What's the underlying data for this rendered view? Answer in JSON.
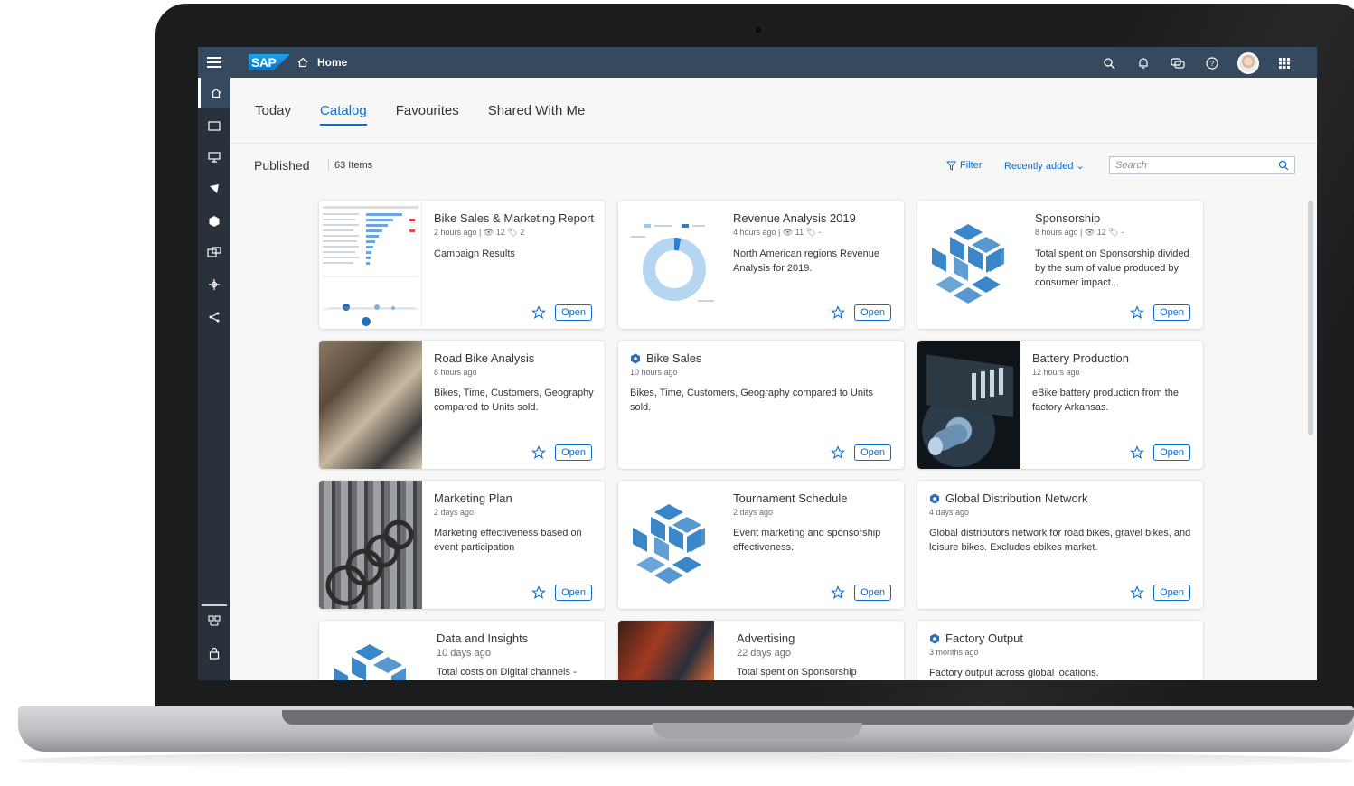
{
  "shell": {
    "logo": "SAP",
    "home_label": "Home"
  },
  "tabs": [
    {
      "label": "Today"
    },
    {
      "label": "Catalog",
      "active": true
    },
    {
      "label": "Favourites"
    },
    {
      "label": "Shared With Me"
    }
  ],
  "toolbar": {
    "title": "Published",
    "count": "63 Items",
    "filter_label": "Filter",
    "sort_label": "Recently added",
    "search_placeholder": "Search"
  },
  "open_label": "Open",
  "cards": [
    {
      "title": "Bike Sales & Marketing Report",
      "meta": "2 hours ago | 👁 12 🏷 2",
      "desc": "Campaign Results"
    },
    {
      "title": "Revenue Analysis 2019",
      "meta": "4 hours ago | 👁 11 🏷 -",
      "desc": "North American regions Revenue Analysis for 2019."
    },
    {
      "title": "Sponsorship",
      "meta": "8 hours ago | 👁 12 🏷 -",
      "desc": "Total spent on Sponsorship divided by the sum of value produced by consumer impact..."
    },
    {
      "title": "Road Bike Analysis",
      "meta": "8 hours ago",
      "desc": "Bikes, Time, Customers, Geography compared to Units sold."
    },
    {
      "title": "Bike Sales",
      "meta": "10 hours ago",
      "desc": "Bikes, Time, Customers, Geography compared to Units sold."
    },
    {
      "title": "Battery Production",
      "meta": "12 hours ago",
      "desc": "eBike battery production from the factory Arkansas."
    },
    {
      "title": "Marketing Plan",
      "meta": "2 days ago",
      "desc": "Marketing effectiveness based on event participation"
    },
    {
      "title": "Tournament Schedule",
      "meta": "2 days ago",
      "desc": "Event marketing and sponsorship effectiveness."
    },
    {
      "title": "Global Distribution Network",
      "meta": "4 days ago",
      "desc": "Global distributors network for road bikes, gravel bikes, and leisure bikes. Excludes ebikes market."
    },
    {
      "title": "Data and Insights",
      "meta": "10 days ago",
      "desc": "Total costs on Digital channels -"
    },
    {
      "title": "Advertising",
      "meta": "22 days ago",
      "desc": "Total spent on Sponsorship"
    },
    {
      "title": "Factory Output",
      "meta": "3 months ago",
      "desc": "Factory output across global locations."
    }
  ],
  "colors": {
    "shell": "#354a5f",
    "sidenav": "#29313a",
    "accent": "#0a6ed1",
    "cube": "#3a86c8"
  }
}
